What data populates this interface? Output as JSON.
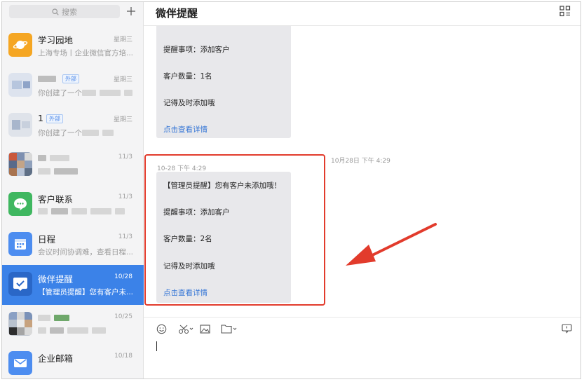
{
  "search": {
    "placeholder": "搜索"
  },
  "sidebar": {
    "items": [
      {
        "title": "学习园地",
        "time": "星期三",
        "preview": "上海专场丨企业微信官方培..."
      },
      {
        "title": "",
        "badge": "外部",
        "time": "星期三",
        "preview": "你创建了一个"
      },
      {
        "title": "1",
        "badge": "外部",
        "time": "星期三",
        "preview": "你创建了一个"
      },
      {
        "title": "",
        "time": "11/3",
        "preview": ""
      },
      {
        "title": "客户联系",
        "time": "11/3",
        "preview": ""
      },
      {
        "title": "日程",
        "time": "11/3",
        "preview": "会议时间协调难，查看日程..."
      },
      {
        "title": "微伴提醒",
        "time": "10/28",
        "preview": "【管理员提醒】您有客户未..."
      },
      {
        "title": "",
        "time": "10/25",
        "preview": ""
      },
      {
        "title": "企业邮箱",
        "time": "10/18",
        "preview": ""
      }
    ]
  },
  "chat": {
    "title": "微伴提醒",
    "message1": {
      "item_line": "提醒事项：添加客户",
      "count_line": "客户数量：1名",
      "reminder_line": "记得及时添加哦",
      "link": "点击查看详情"
    },
    "divider_time": "10月28日 下午 4:29",
    "message2": {
      "time": "10-28 下午 4:29",
      "header_line": "【管理员提醒】您有客户未添加哦！",
      "item_line": "提醒事项：添加客户",
      "count_line": "客户数量：2名",
      "reminder_line": "记得及时添加哦",
      "link": "点击查看详情"
    }
  },
  "colors": {
    "active": "#3b82e8",
    "highlight": "#e23b2c",
    "link": "#3777d6"
  },
  "icons": [
    "search-icon",
    "plus-icon",
    "grid-icon",
    "emoji-icon",
    "scissors-icon",
    "image-icon",
    "folder-icon",
    "message-icon",
    "arrow"
  ]
}
